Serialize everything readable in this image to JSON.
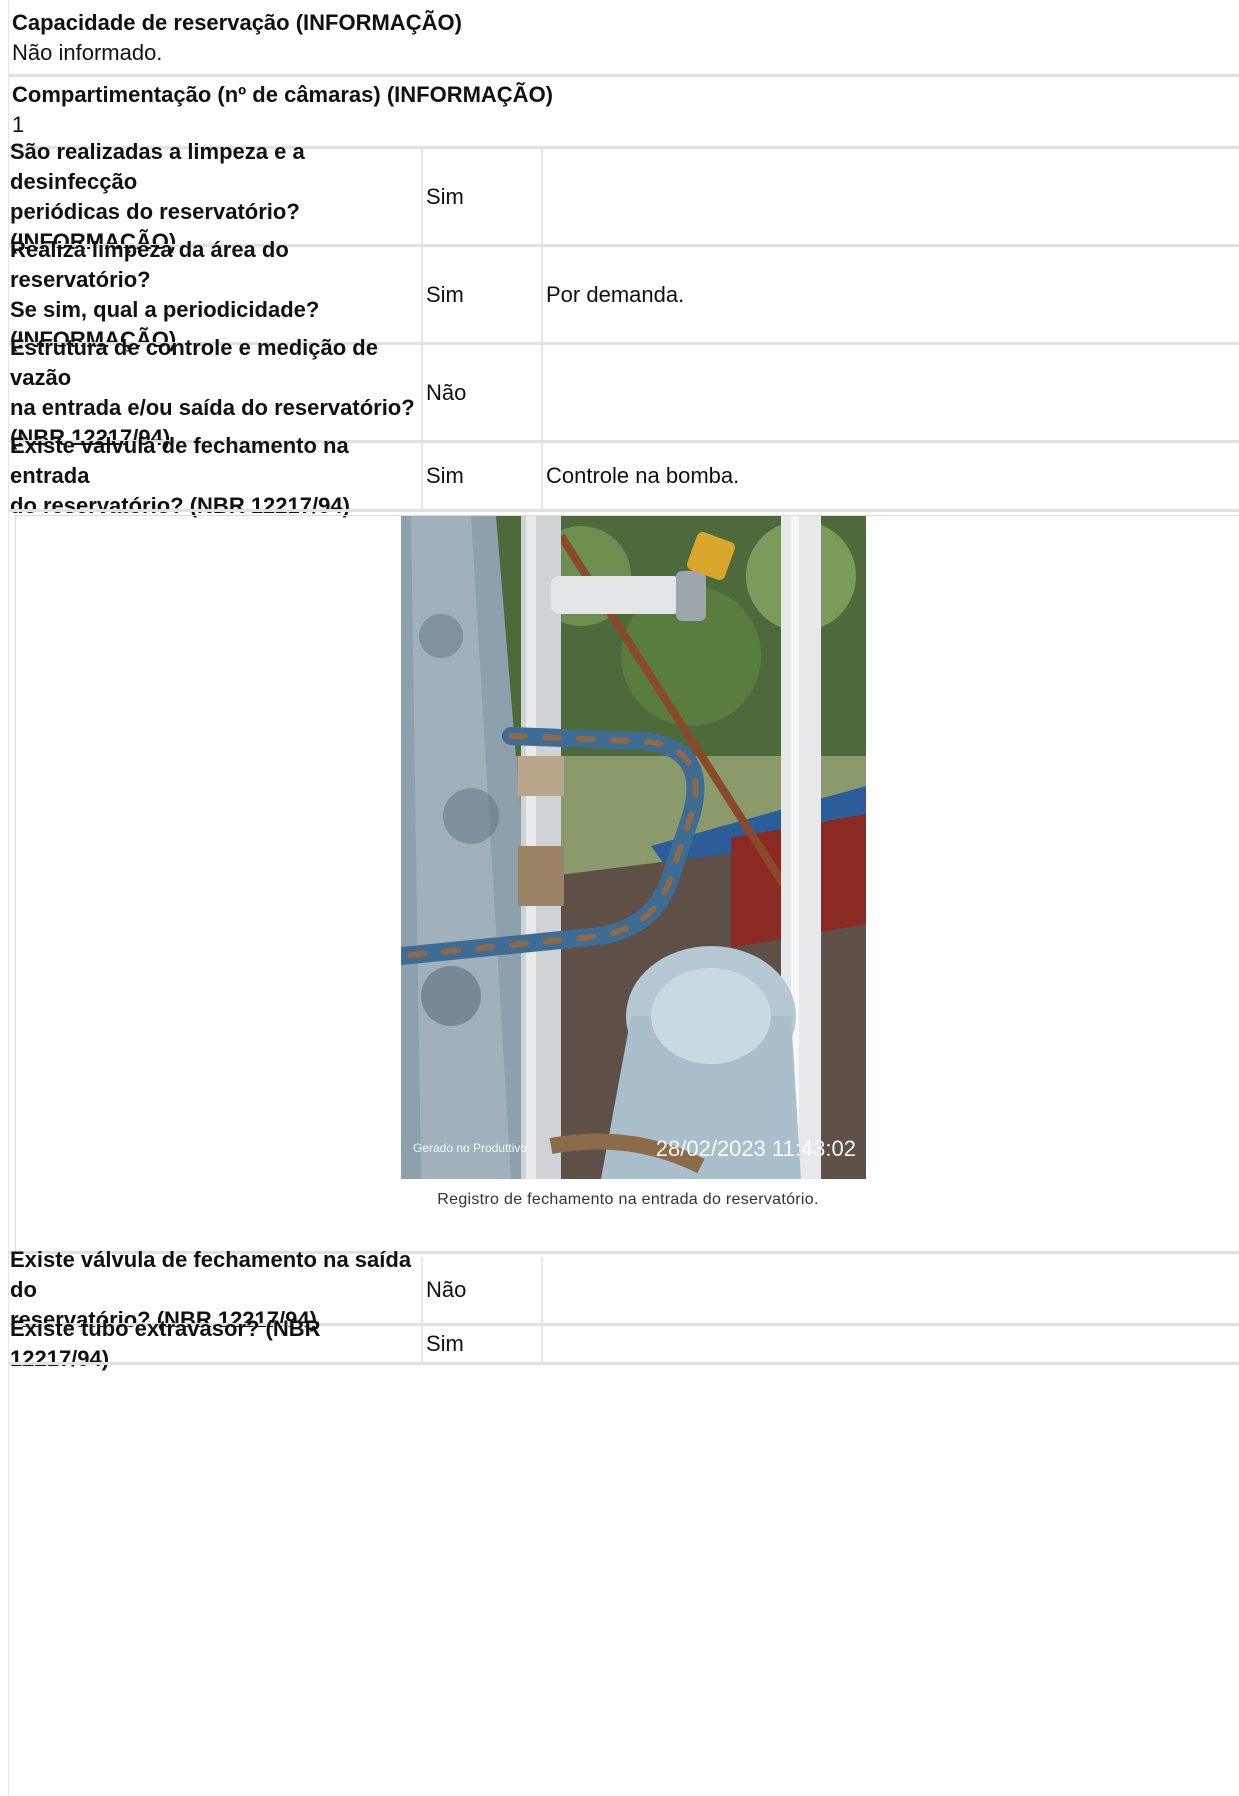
{
  "info_blocks": [
    {
      "label": "Capacidade de reservação (INFORMAÇÃO)",
      "value": "Não informado."
    },
    {
      "label": "Compartimentação (nº de câmaras) (INFORMAÇÃO)",
      "value": "1"
    }
  ],
  "rows": [
    {
      "question": [
        "São realizadas a limpeza e a desinfecção",
        "periódicas do reservatório?",
        "(INFORMAÇÃO)"
      ],
      "answer": "Sim",
      "note": ""
    },
    {
      "question": [
        "Realiza limpeza da área do reservatório?",
        "Se sim, qual a periodicidade?",
        "(INFORMAÇÃO)"
      ],
      "answer": "Sim",
      "note": "Por demanda."
    },
    {
      "question": [
        "Estrutura de controle e medição de vazão",
        "na entrada e/ou saída do reservatório?",
        "(NBR 12217/94)"
      ],
      "answer": "Não",
      "note": ""
    },
    {
      "question": [
        "Existe válvula de fechamento na entrada",
        "do reservatório? (NBR 12217/94)"
      ],
      "answer": "Sim",
      "note": "Controle na bomba."
    }
  ],
  "photo": {
    "watermark_left": "Gerado no Produttivo",
    "timestamp": "28/02/2023 11:43:02",
    "caption": "Registro de fechamento na entrada do reservatório."
  },
  "rows_after": [
    {
      "question": [
        "Existe válvula de fechamento na saída do",
        "reservatório? (NBR 12217/94)"
      ],
      "answer": "Não",
      "note": ""
    },
    {
      "question": [
        "Existe tubo extravasor? (NBR 12217/94)"
      ],
      "answer": "Sim",
      "note": ""
    }
  ]
}
